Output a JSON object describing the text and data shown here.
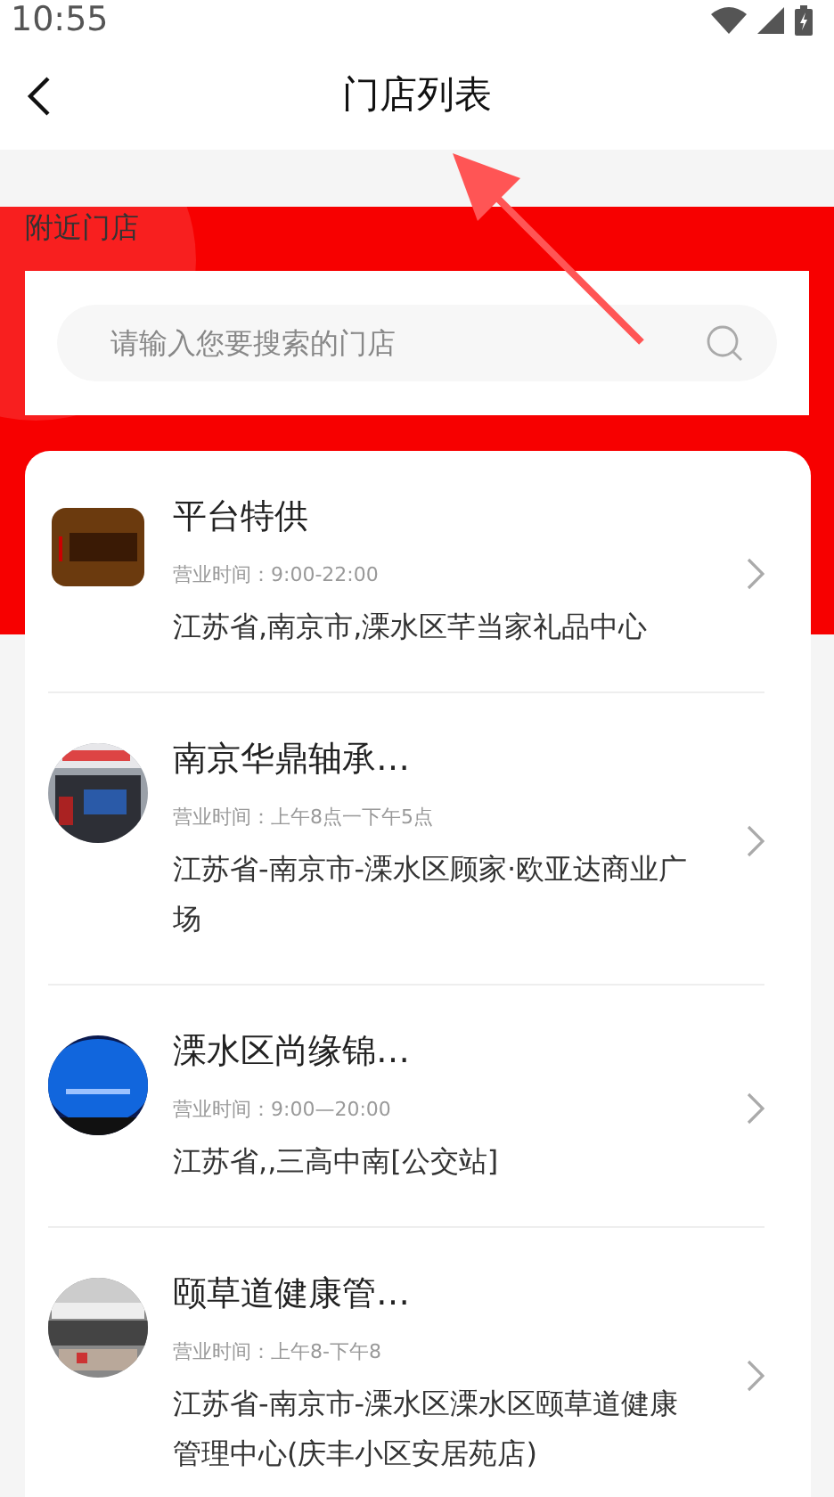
{
  "status_bar": {
    "time": "10:55"
  },
  "header": {
    "title": "门店列表"
  },
  "section": {
    "title": "附近门店"
  },
  "search": {
    "placeholder": "请输入您要搜索的门店"
  },
  "stores": [
    {
      "name": "平台特供",
      "hours": "营业时间：9:00-22:00",
      "address": "江苏省,南京市,溧水区芊当家礼品中心"
    },
    {
      "name": "南京华鼎轴承…",
      "hours": "营业时间：上午8点一下午5点",
      "address": "江苏省-南京市-溧水区顾家·欧亚达商业广场"
    },
    {
      "name": "溧水区尚缘锦…",
      "hours": "营业时间：9:00—20:00",
      "address": "江苏省,,三高中南[公交站]"
    },
    {
      "name": "颐草道健康管…",
      "hours": "营业时间：上午8-下午8",
      "address": "江苏省-南京市-溧水区溧水区颐草道健康管理中心(庆丰小区安居苑店)"
    }
  ]
}
